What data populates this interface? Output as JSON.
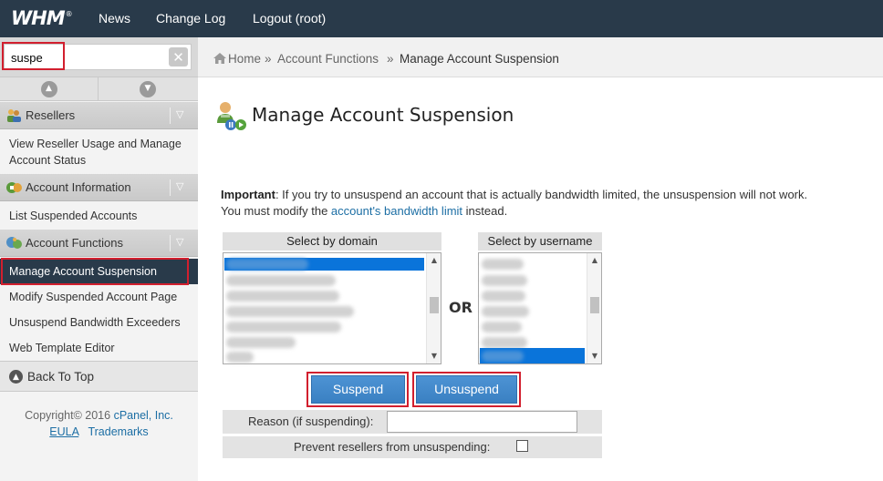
{
  "topbar": {
    "logo": "WHM",
    "nav": [
      "News",
      "Change Log",
      "Logout (root)"
    ]
  },
  "sidebar": {
    "search": {
      "value": "suspe",
      "clear_icon": "x-icon"
    },
    "sections": [
      {
        "label": "Resellers",
        "links": [
          "View Reseller Usage and Manage Account Status"
        ]
      },
      {
        "label": "Account Information",
        "links": [
          "List Suspended Accounts"
        ]
      },
      {
        "label": "Account Functions",
        "links": [
          "Manage Account Suspension",
          "Modify Suspended Account Page",
          "Unsuspend Bandwidth Exceeders",
          "Web Template Editor"
        ]
      }
    ],
    "active": "Manage Account Suspension",
    "back_to_top": "Back To Top",
    "copyright_prefix": "Copyright© 2016",
    "copyright_company": "cPanel, Inc.",
    "eula": "EULA",
    "trademarks": "Trademarks"
  },
  "breadcrumb": {
    "home": "Home",
    "sep": "»",
    "parent": "Account Functions",
    "current": "Manage Account Suspension"
  },
  "main": {
    "title": "Manage Account Suspension",
    "important_label": "Important",
    "important_text_1": ": If you try to unsuspend an account that is actually bandwidth limited, the unsuspension will not work.",
    "important_text_2a": "You must modify the ",
    "important_link": "account's bandwidth limit",
    "important_text_2b": " instead.",
    "by_domain_label": "Select by domain",
    "by_username_label": "Select by username",
    "or_label": "OR",
    "suspend_button": "Suspend",
    "unsuspend_button": "Unsuspend",
    "reason_label": "Reason (if suspending):",
    "reason_value": "",
    "prevent_label": "Prevent resellers from unsuspending:",
    "prevent_checked": false
  },
  "colors": {
    "topbar": "#293a4a",
    "accent_button": "#3a80c2",
    "highlight_outline": "#d21f2e",
    "link": "#1c6ea4"
  }
}
